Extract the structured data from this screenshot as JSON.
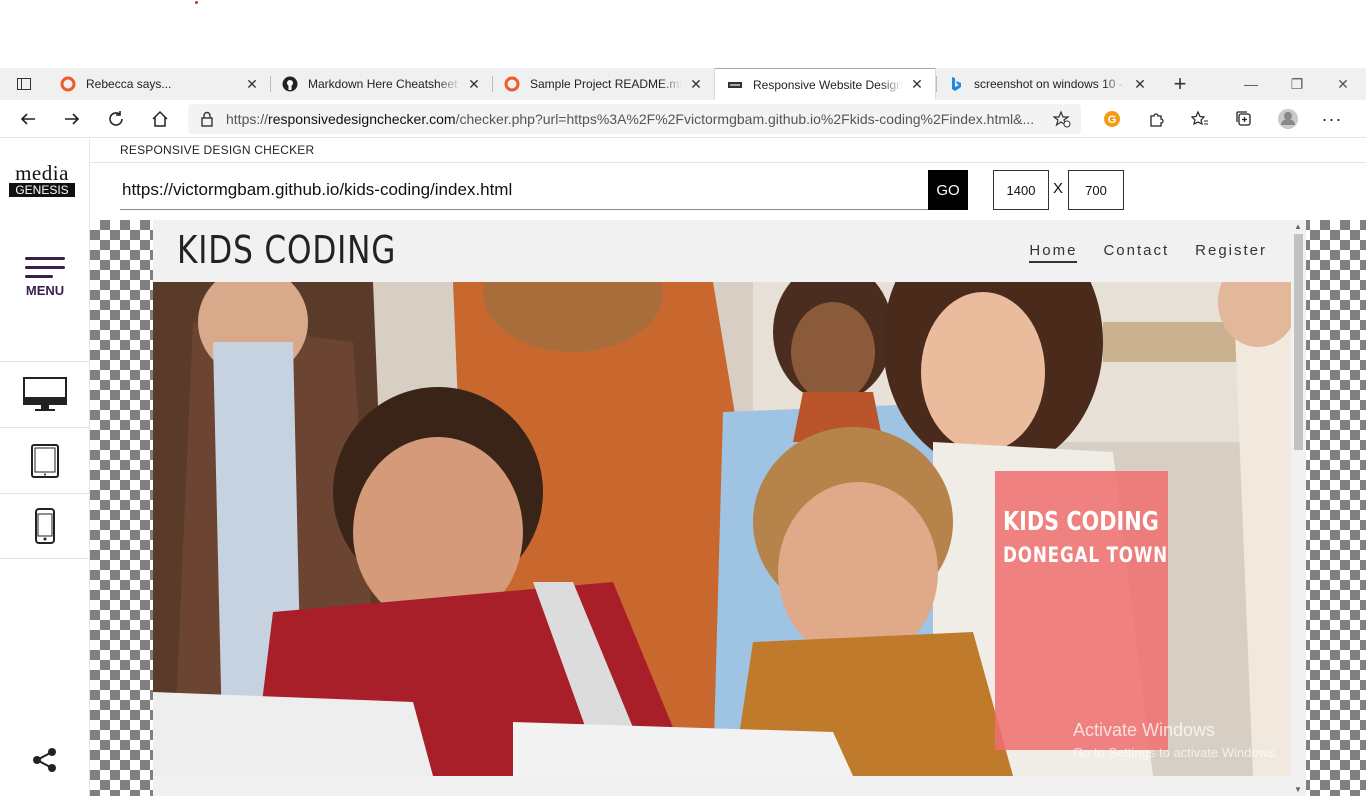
{
  "browser": {
    "tabs": [
      {
        "title": "Rebecca says...",
        "favicon": "circle-icon",
        "active": false
      },
      {
        "title": "Markdown Here Cheatsheet ·",
        "favicon": "github-icon",
        "active": false
      },
      {
        "title": "Sample Project README.md |",
        "favicon": "circle-icon",
        "active": false
      },
      {
        "title": "Responsive Website Design T",
        "favicon": "checker-icon",
        "active": true
      },
      {
        "title": "screenshot on windows 10 - S",
        "favicon": "bing-icon",
        "active": false
      }
    ],
    "address": {
      "scheme": "https://",
      "host": "responsivedesignchecker.com",
      "path": "/checker.php?url=https%3A%2F%2Fvictormgbam.github.io%2Fkids-coding%2Findex.html&..."
    }
  },
  "app": {
    "logo_line1": "media",
    "logo_line2": "GENESIS",
    "menu_label": "MENU",
    "title": "RESPONSIVE DESIGN CHECKER",
    "url_value": "https://victormgbam.github.io/kids-coding/index.html",
    "go_label": "GO",
    "width_value": "1400",
    "height_value": "700",
    "x_label": "X"
  },
  "site": {
    "logo": "KIDS CODING",
    "nav": [
      "Home",
      "Contact",
      "Register"
    ],
    "hero_title": "KIDS CODING",
    "hero_subtitle": "DONEGAL TOWN"
  },
  "overlay": {
    "activate_title": "Activate Windows",
    "activate_sub": "Go to Settings to activate Windows."
  },
  "colors": {
    "menu_accent": "#3b1f4b",
    "hero_box": "#f06e6e"
  }
}
